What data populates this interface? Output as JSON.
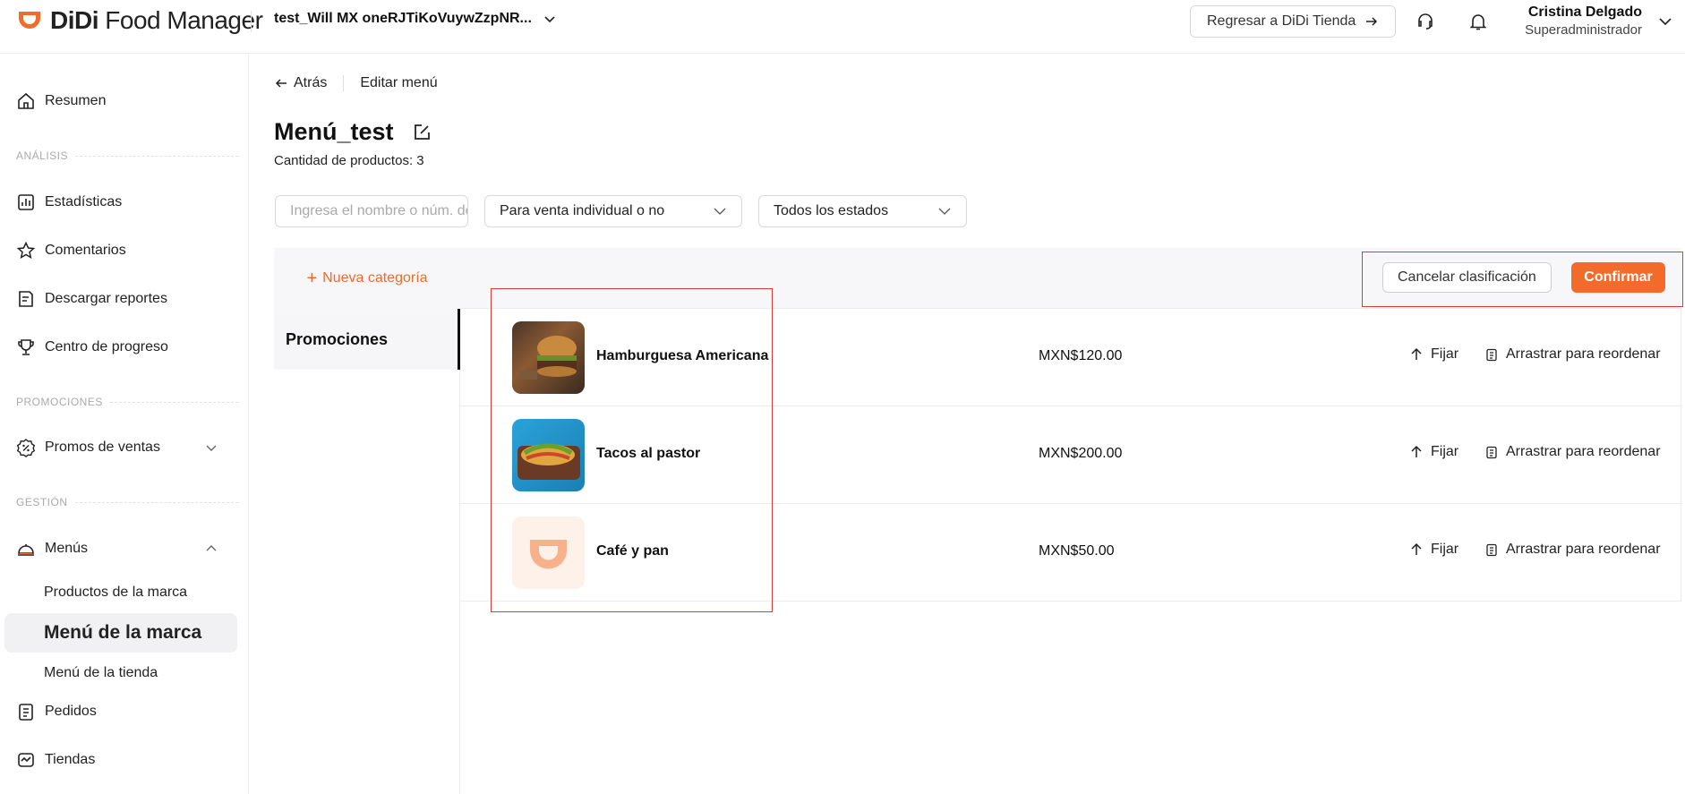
{
  "brand": {
    "name_bold": "DiDi",
    "name_rest": " Food Manager",
    "accent": "#f26b2a"
  },
  "header": {
    "account": "test_Will MX oneRJTiKoVuywZzpNR...",
    "back_button": "Regresar a DiDi Tienda",
    "user_name": "Cristina Delgado",
    "user_role": "Superadministrador"
  },
  "sidebar": {
    "resumen": "Resumen",
    "section_analisis": "ANÁLISIS",
    "estadisticas": "Estadísticas",
    "comentarios": "Comentarios",
    "descargar": "Descargar reportes",
    "progreso": "Centro de progreso",
    "section_promociones": "PROMOCIONES",
    "promos": "Promos de ventas",
    "section_gestion": "GESTIÓN",
    "menus": "Menús",
    "productos_marca": "Productos de la marca",
    "menu_marca": "Menú de la marca",
    "menu_tienda": "Menú de la tienda",
    "pedidos": "Pedidos",
    "tiendas": "Tiendas"
  },
  "breadcrumb": {
    "back": "Atrás",
    "current": "Editar menú"
  },
  "page": {
    "title": "Menú_test",
    "count": "Cantidad de productos: 3"
  },
  "filters": {
    "search_placeholder": "Ingresa el nombre o núm. de producto",
    "sale_type": "Para venta individual o no",
    "status": "Todos los estados"
  },
  "categories": {
    "new": "Nueva categoría",
    "items": [
      "Promociones"
    ]
  },
  "actions": {
    "cancel": "Cancelar clasificación",
    "confirm": "Confirmar"
  },
  "products": [
    {
      "name": "Hamburguesa Americana",
      "price": "MXN$120.00",
      "pin": "Fijar",
      "drag": "Arrastrar para reordenar"
    },
    {
      "name": "Tacos al pastor",
      "price": "MXN$200.00",
      "pin": "Fijar",
      "drag": "Arrastrar para reordenar"
    },
    {
      "name": "Café y pan",
      "price": "MXN$50.00",
      "pin": "Fijar",
      "drag": "Arrastrar para reordenar"
    }
  ]
}
